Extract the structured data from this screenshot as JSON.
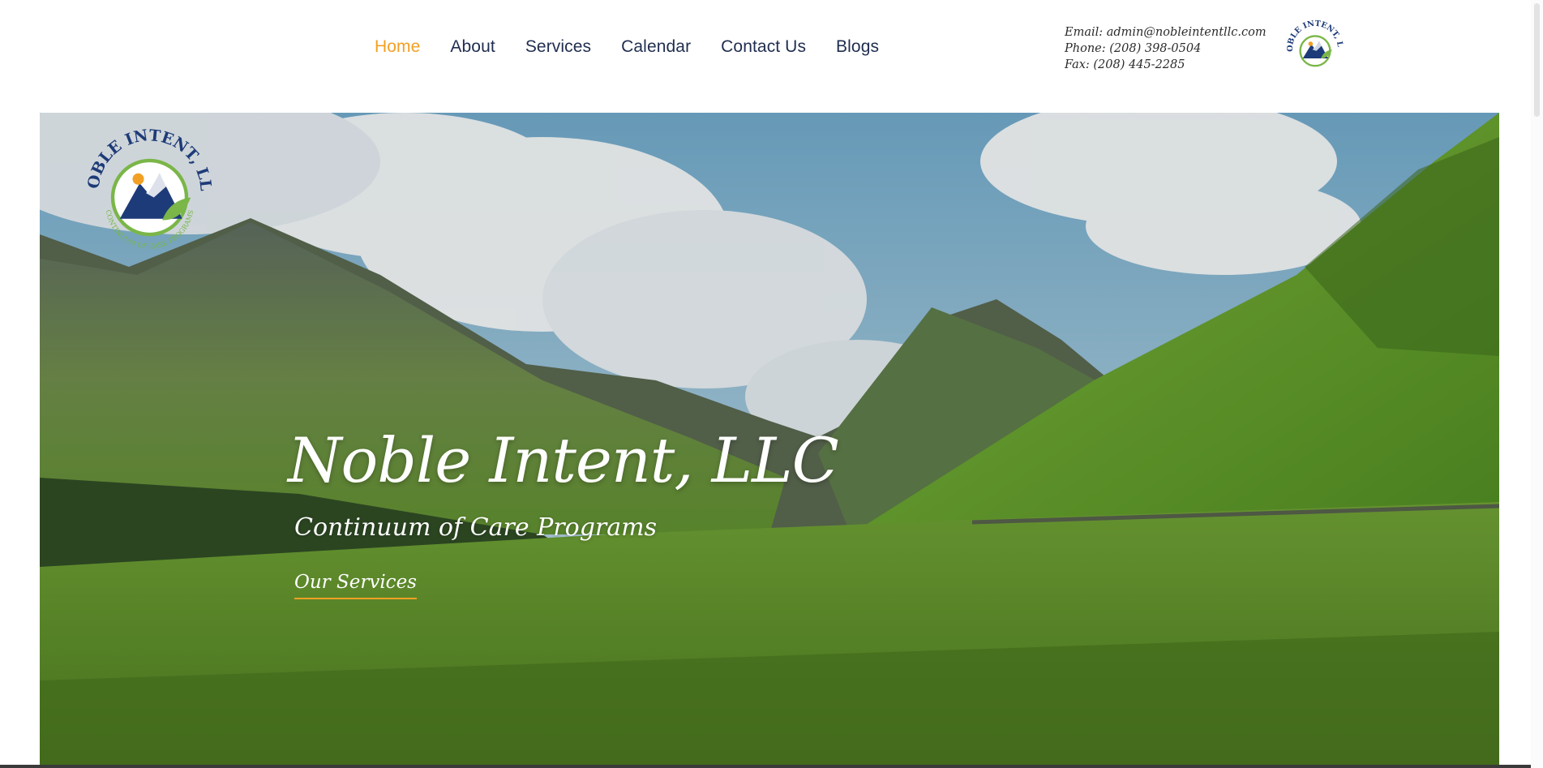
{
  "nav": {
    "items": [
      {
        "label": "Home",
        "active": true
      },
      {
        "label": "About"
      },
      {
        "label": "Services"
      },
      {
        "label": "Calendar"
      },
      {
        "label": "Contact Us"
      },
      {
        "label": "Blogs"
      }
    ]
  },
  "contact": {
    "email": "Email: admin@nobleintentllc.com",
    "phone": "Phone: (208) 398-0504",
    "fax": "Fax: (208) 445-2285"
  },
  "logo": {
    "name": "NOBLE INTENT, LLC",
    "tagline": "CONTINUUM OF CARE PROGRAMS"
  },
  "hero": {
    "title": "Noble Intent, LLC",
    "subtitle": "Continuum of Care Programs",
    "cta": "Our Services"
  },
  "colors": {
    "accent": "#f2a024",
    "nav_text": "#1f2d4f",
    "logo_navy": "#1d3b78",
    "logo_green": "#7ab648"
  }
}
